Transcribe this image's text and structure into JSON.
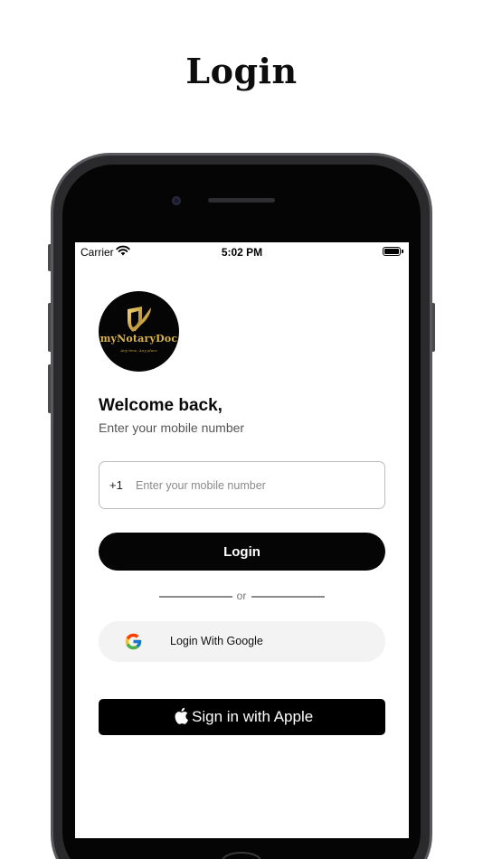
{
  "page": {
    "heading": "Login"
  },
  "status_bar": {
    "carrier": "Carrier",
    "time": "5:02 PM"
  },
  "logo": {
    "name": "myNotaryDoc",
    "tagline": "Any time, Any place",
    "colors": {
      "background": "#050505",
      "gold": "#d8b24a"
    }
  },
  "welcome": {
    "title": "Welcome back,",
    "subtitle": "Enter your mobile number"
  },
  "mobile_field": {
    "country_code": "+1",
    "value": "",
    "placeholder": "Enter your mobile number"
  },
  "login_button": {
    "label": "Login"
  },
  "divider": {
    "label": "or"
  },
  "google_button": {
    "label": "Login With Google",
    "icon": "google-icon"
  },
  "apple_button": {
    "label": "Sign in with Apple",
    "icon": "apple-icon"
  },
  "colors": {
    "primary_button": "#050505",
    "google_button_bg": "#f3f3f3",
    "field_border": "#bdbdbd"
  }
}
